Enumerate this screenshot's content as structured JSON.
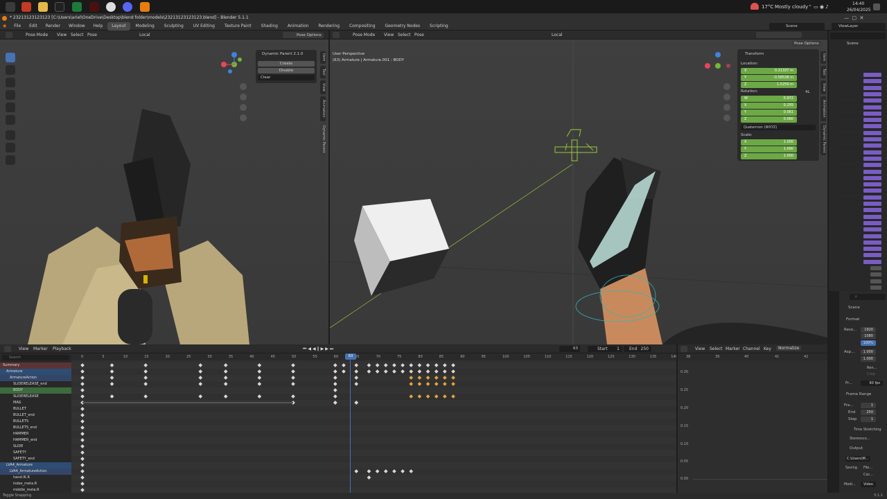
{
  "taskbar": {
    "weather_temp": "17°C",
    "weather_text": "Mostly cloudy",
    "time": "14:40",
    "date": "26/04/2025"
  },
  "window_title": "* 23213123123123 [C:\\Users\\ariel\\OneDrive\\Desktop\\blend folder\\models\\23213123123123.blend] - Blender 5.1.1",
  "menu": [
    "File",
    "Edit",
    "Render",
    "Window",
    "Help"
  ],
  "workspaces": [
    "Layout",
    "Modeling",
    "Sculpting",
    "UV Editing",
    "Texture Paint",
    "Shading",
    "Animation",
    "Rendering",
    "Compositing",
    "Geometry Nodes",
    "Scripting"
  ],
  "scene": "Scene",
  "view_layer": "ViewLayer",
  "left_vp": {
    "mode": "Pose Mode",
    "menus": [
      "View",
      "Select",
      "Pose"
    ],
    "orientation": "Local",
    "pose_options": "Pose Options",
    "dp_panel": {
      "title": "Dynamic Parent 2.1.0",
      "create": "Create",
      "disable": "Disable",
      "clear": "Clear"
    },
    "tabs": [
      "Item",
      "Tool",
      "View",
      "Animation",
      "Dynamic Parent"
    ]
  },
  "right_vp": {
    "mode": "Pose Mode",
    "menus": [
      "View",
      "Select",
      "Pose"
    ],
    "orientation": "Local",
    "pose_options": "Pose Options",
    "overlay_line1": "User Perspective",
    "overlay_line2": "(63) Armature | Armature.001 : BODY",
    "transform": {
      "title": "Transform",
      "location_label": "Location:",
      "loc": [
        {
          "a": "X",
          "v": "0.21337 m"
        },
        {
          "a": "Y",
          "v": "-0.58538 m"
        },
        {
          "a": "Z",
          "v": "1.5259 m"
        }
      ],
      "rotation_label": "Rotation:",
      "rot": [
        {
          "a": "W",
          "v": "0.972"
        },
        {
          "a": "X",
          "v": "0.255"
        },
        {
          "a": "Y",
          "v": "0.061"
        },
        {
          "a": "Z",
          "v": "0.060"
        }
      ],
      "rot_mode": "Quaternion (WXYZ)",
      "scale_label": "Scale:",
      "scale": [
        {
          "a": "X",
          "v": "1.000"
        },
        {
          "a": "Y",
          "v": "1.000"
        },
        {
          "a": "Z",
          "v": "1.000"
        }
      ],
      "side_val": "4L"
    },
    "tabs": [
      "Item",
      "Tool",
      "View",
      "Animation",
      "Dynamic Parent"
    ]
  },
  "dopesheet": {
    "menus": [
      "View",
      "Marker",
      "Playback"
    ],
    "current_frame": "63",
    "start_label": "Start",
    "start": "1",
    "end_label": "End",
    "end": "250",
    "search_placeholder": "Search",
    "ticks": [
      "0",
      "5",
      "10",
      "15",
      "20",
      "25",
      "30",
      "35",
      "40",
      "45",
      "50",
      "55",
      "60",
      "65",
      "70",
      "75",
      "80",
      "85",
      "90",
      "95",
      "100",
      "105",
      "110",
      "115",
      "120",
      "125",
      "130",
      "135",
      "140"
    ],
    "channels": [
      "Summary",
      "Armature",
      "ArmatureAction",
      "SLIDERELEASE_end",
      "BODY",
      "SLIDERELEASE",
      "MAG",
      "BULLET",
      "BULLET_end",
      "BULLETS",
      "BULLETS_end",
      "HAMMER",
      "HAMMER_end",
      "SLIDE",
      "SAFETY",
      "SAFETY_end",
      "LVA4_Armature",
      "LVA4_ArmatureAction",
      "hand.IK.R",
      "index_meta.R",
      "middle_meta.R"
    ]
  },
  "graph": {
    "menus": [
      "View",
      "Select",
      "Marker",
      "Channel",
      "Key"
    ],
    "normalize": "Normalize",
    "ticks": [
      "38",
      "39",
      "40",
      "41",
      "42"
    ],
    "yticks": [
      "0.30",
      "0.25",
      "0.20",
      "0.15",
      "0.10",
      "0.05",
      "0.00"
    ]
  },
  "outliner": {
    "search_placeholder": "Search",
    "scene": "Scene"
  },
  "properties": {
    "scene": "Scene",
    "format": "Format",
    "res_x_label": "Reso...",
    "res_x": "1920",
    "res_y": "1080",
    "res_pct": "100%",
    "aspect_label": "Asp...",
    "asp_x": "1.000",
    "asp_y": "1.000",
    "render_region": "Ren...",
    "crop": "Crop",
    "fps_label": "Fr...",
    "fps": "60 fps",
    "frame_range": "Frame Range",
    "frame_start_label": "Fra...",
    "frame_start": "1",
    "end_label": "End",
    "end": "250",
    "step_label": "Step",
    "step": "1",
    "time_stretching": "Time Stretching",
    "stereoscopy": "Stereosco...",
    "output": "Output",
    "path": "C:\\Users\\M...",
    "saving": "Saving",
    "file_ext": "File...",
    "cache": "Cac...",
    "media": "Medi...",
    "video": "Video"
  },
  "status": {
    "left": "Toggle Snapping",
    "version": "5.1.1"
  }
}
